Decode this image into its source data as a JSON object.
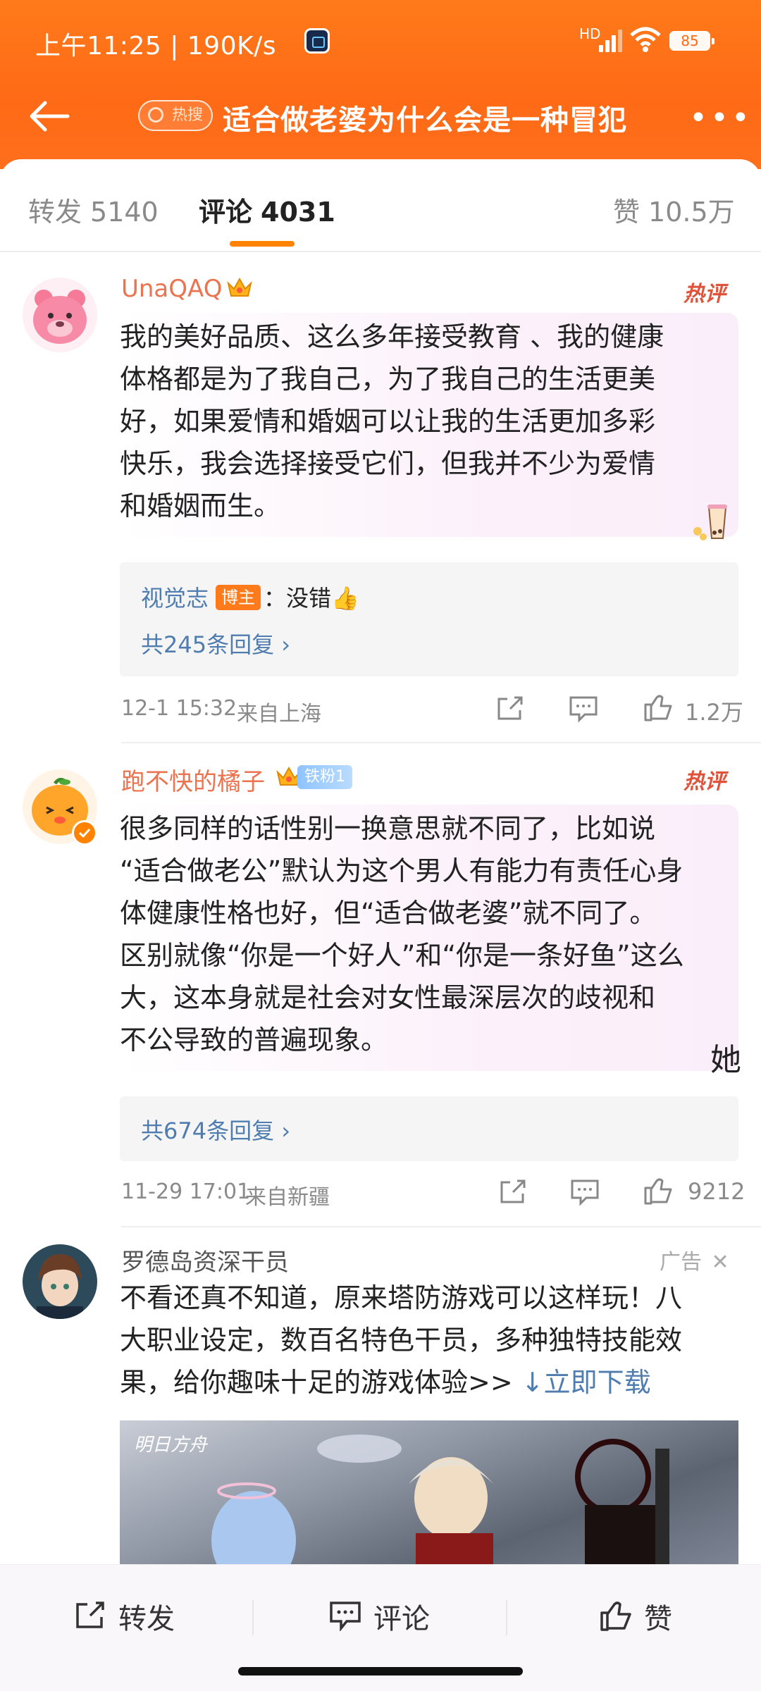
{
  "status_bar": {
    "time": "上午11:25 | 190K/s",
    "signal_label": "HD",
    "battery": "85"
  },
  "nav": {
    "hot_tag": "热搜",
    "title": "适合做老婆为什么会是一种冒犯",
    "more": "•••"
  },
  "tabs": [
    {
      "label": "转发",
      "count": "5140",
      "active": false
    },
    {
      "label": "评论",
      "count": "4031",
      "active": true
    },
    {
      "label": "赞",
      "count": "10.5万",
      "active": false
    }
  ],
  "comments": [
    {
      "username": "UnaQAQ",
      "hot_label": "热评",
      "text_lines": [
        "我的美好品质、这么多年接受教育 、我的健康",
        "体格都是为了我自己，为了我自己的生活更美",
        "好，如果爱情和婚姻可以让我的生活更加多彩",
        "快乐，我会选择接受它们，但我并不少为爱情",
        "和婚姻而生。"
      ],
      "reply": {
        "author": "视觉志",
        "badge": "博主",
        "colon": "：",
        "text": "没错👍",
        "count": "共245条回复 ›"
      },
      "time": "12-1 15:32",
      "location": "来自上海",
      "likes": "1.2万"
    },
    {
      "username": "跑不快的橘子",
      "fan_badge": "铁粉1",
      "hot_label": "热评",
      "text_lines": [
        "很多同样的话性别一换意思就不同了，比如说",
        "“适合做老公”默认为这个男人有能力有责任心身",
        "体健康性格也好，但“适合做老婆”就不同了。",
        "区别就像“你是一个好人”和“你是一条好鱼”这么",
        "大，这本身就是社会对女性最深层次的歧视和",
        "不公导致的普遍现象。"
      ],
      "handwrite": "她",
      "reply": {
        "count": "共674条回复 ›"
      },
      "time": "11-29 17:01",
      "location": "来自新疆",
      "likes": "9212"
    }
  ],
  "ad": {
    "name": "罗德岛资深干员",
    "label": "广告",
    "close": "✕",
    "text_lines": [
      "不看还真不知道，原来塔防游戏可以这样玩！八",
      "大职业设定，数百名特色干员，多种独特技能效"
    ],
    "last_line": "果，给你趣味十足的游戏体验>> ",
    "link": "↓立即下载",
    "logo_text": "明日方舟"
  },
  "bottom_bar": {
    "repost": "转发",
    "comment": "评论",
    "like": "赞"
  },
  "colors": {
    "brand_orange": "#ff6a16",
    "username_orange": "#eb7350",
    "link_blue": "#507daf",
    "hot_red": "#e0533b"
  }
}
